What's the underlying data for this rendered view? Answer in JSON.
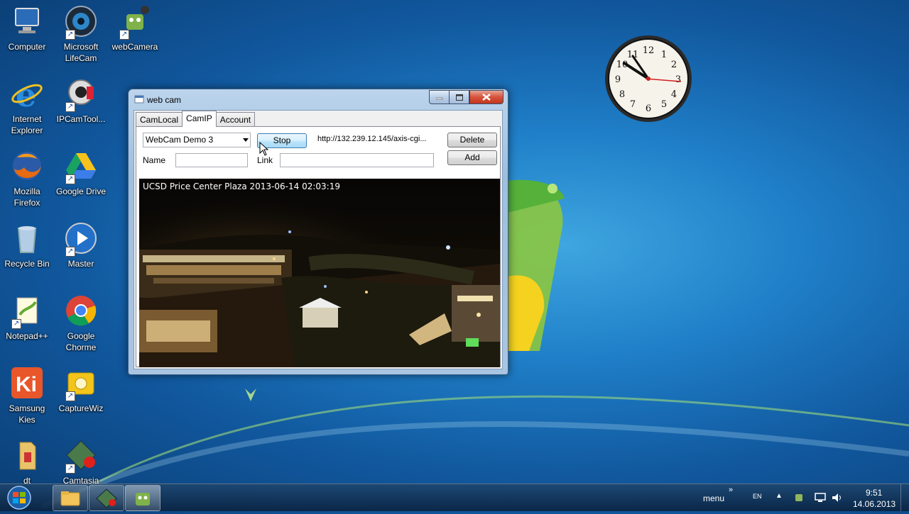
{
  "desktop_icons": [
    {
      "label": "Computer",
      "icon": "computer-icon"
    },
    {
      "label": "Microsoft LifeCam",
      "icon": "lifecam-icon"
    },
    {
      "label": "webCamera",
      "icon": "webcamera-app-icon"
    },
    {
      "label": "Internet Explorer",
      "icon": "internet-explorer-icon"
    },
    {
      "label": "IPCamTool...",
      "icon": "ipcamtool-icon"
    },
    {
      "label": "Mozilla Firefox",
      "icon": "firefox-icon"
    },
    {
      "label": "Google Drive",
      "icon": "google-drive-icon"
    },
    {
      "label": "Recycle Bin",
      "icon": "recycle-bin-icon"
    },
    {
      "label": "Master",
      "icon": "master-icon"
    },
    {
      "label": "Notepad++",
      "icon": "notepad-plus-plus-icon"
    },
    {
      "label": "Google Chorme",
      "icon": "google-chrome-icon"
    },
    {
      "label": "Samsung Kies",
      "icon": "samsung-kies-icon"
    },
    {
      "label": "CaptureWiz",
      "icon": "capturewiz-icon"
    },
    {
      "label": "dt",
      "icon": "folder-icon"
    },
    {
      "label": "Camtasia",
      "icon": "camtasia-icon"
    }
  ],
  "window": {
    "title": "web cam",
    "tabs": [
      "CamLocal",
      "CamIP",
      "Account"
    ],
    "active_tab": "CamIP",
    "camera_select": "WebCam Demo 3",
    "stop_button": "Stop",
    "url_text": "http://132.239.12.145/axis-cgi...",
    "delete_button": "Delete",
    "add_button": "Add",
    "name_label": "Name",
    "name_value": "",
    "link_label": "Link",
    "link_value": "",
    "video_overlay": "UCSD Price Center Plaza 2013-06-14 02:03:19"
  },
  "taskbar": {
    "toolbar_label": "menu",
    "language": "EN",
    "time": "9:51",
    "date": "14.06.2013",
    "pinned": [
      "explorer-folder-icon",
      "camtasia-icon",
      "webcamera-app-icon"
    ]
  },
  "colors": {
    "accent": "#1f7fc8",
    "close_button": "#c2361d"
  }
}
